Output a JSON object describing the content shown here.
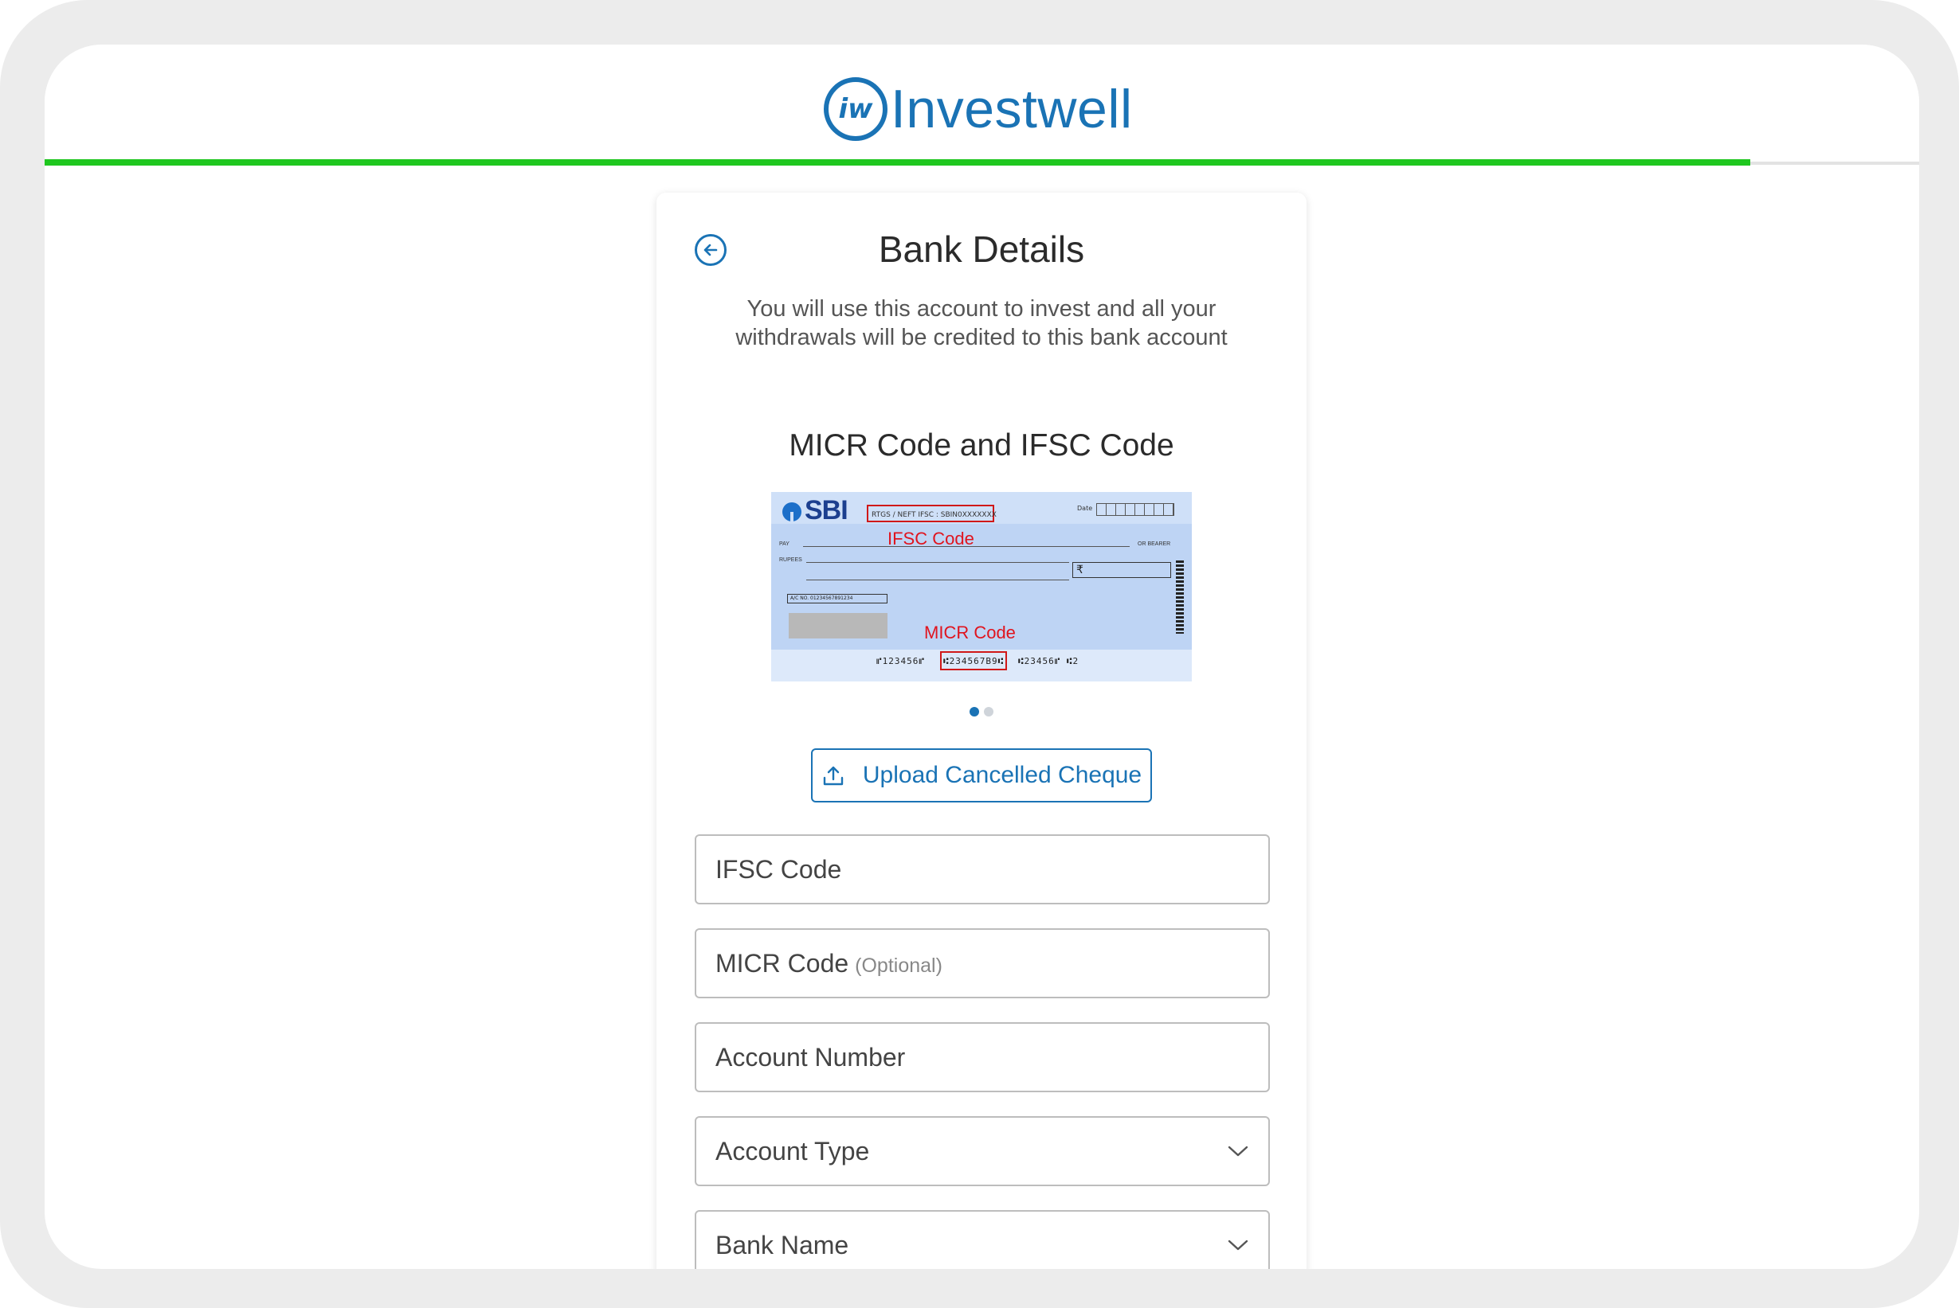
{
  "header": {
    "logo_mark": "iw",
    "logo_text": "Investwell",
    "progress_fraction": 0.91,
    "progress_color": "#1fc71f",
    "brand_color": "#1a73b5"
  },
  "page": {
    "title": "Bank Details",
    "subtitle": "You will use this account to invest and all your withdrawals will be credited to this bank account",
    "back_icon": "arrow-left-circle-icon"
  },
  "carousel": {
    "title": "MICR Code and IFSC Code",
    "slide_count": 2,
    "active_slide": 1,
    "cheque": {
      "bank_logo": "SBI",
      "ifsc_text": "RTGS / NEFT IFSC : SBIN0XXXXXXX",
      "date_label": "Date",
      "pay_label": "PAY",
      "bearer_label": "OR BEARER",
      "rupees_label": "RUPEES",
      "rupee_symbol": "₹",
      "ac_no": "A/C NO.     01234567891234",
      "ifsc_callout": "IFSC Code",
      "micr_callout": "MICR Code",
      "micr_left": "⑈123456⑈",
      "micr_code": "⑆234567B9⑆",
      "micr_right": "⑆23456⑈   ⑆2"
    }
  },
  "upload": {
    "label": "Upload Cancelled Cheque",
    "icon": "upload-icon"
  },
  "form": {
    "ifsc_label": "IFSC Code",
    "micr_label": "MICR Code",
    "micr_optional": "(Optional)",
    "account_number_label": "Account Number",
    "account_type_label": "Account Type",
    "bank_name_label": "Bank Name",
    "dropdown_icon": "chevron-down-icon"
  }
}
